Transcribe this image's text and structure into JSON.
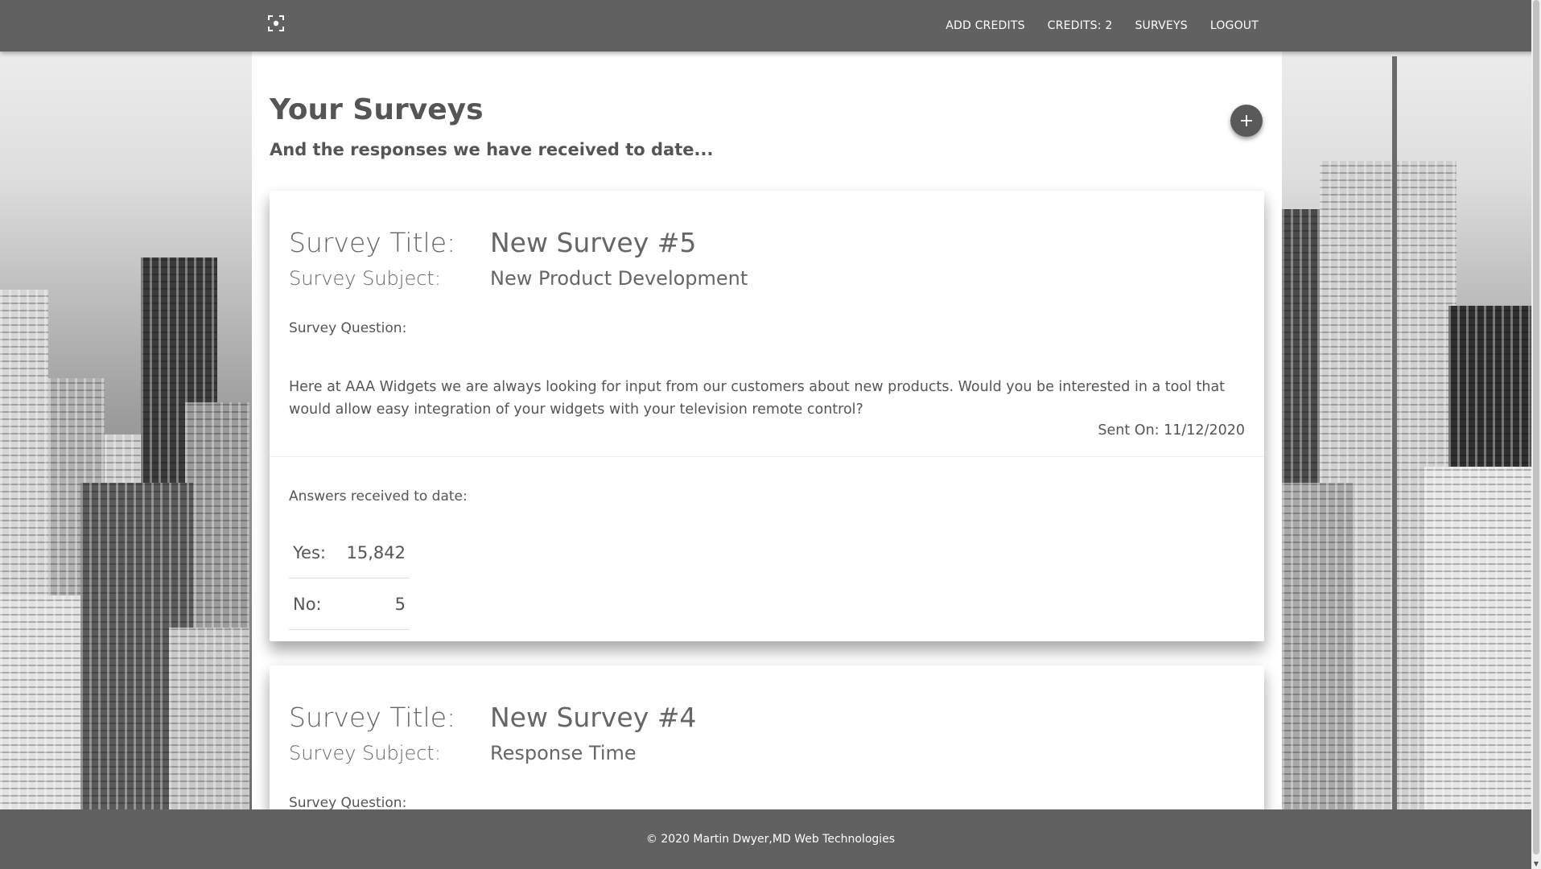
{
  "nav": {
    "logo_icon": "focus-frame-icon",
    "links": [
      "ADD CREDITS",
      "CREDITS: 2",
      "SURVEYS",
      "LOGOUT"
    ]
  },
  "page": {
    "title": "Your Surveys",
    "subtitle": "And the responses we have received to date...",
    "fab_icon": "plus-icon"
  },
  "labels": {
    "survey_title": "Survey Title:",
    "survey_subject": "Survey Subject:",
    "survey_question": "Survey Question:",
    "answers_received": "Answers received to date:",
    "yes": "Yes:",
    "no": "No:"
  },
  "surveys": [
    {
      "title": "New Survey #5",
      "subject": "New Product Development",
      "question": "Here at AAA Widgets we are always looking for input from our customers about new products. Would you be interested in a tool that would allow easy integration of your widgets with your television remote control?",
      "sent_on": "Sent On: 11/12/2020",
      "yes": "15,842",
      "no": "5"
    },
    {
      "title": "New Survey #4",
      "subject": "Response Time"
    }
  ],
  "footer": {
    "text": "© 2020 Martin Dwyer,MD Web Technologies"
  },
  "colors": {
    "nav_bg": "#616161",
    "text_dark": "#555555",
    "fab_bg": "#595959",
    "card_bg": "#ffffff"
  }
}
